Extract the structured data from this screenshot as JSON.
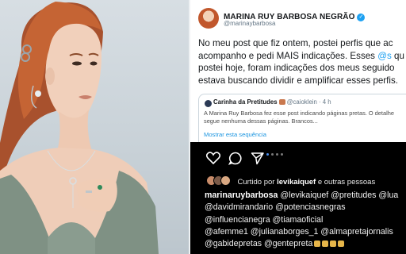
{
  "tweet": {
    "name": "MARINA RUY BARBOSA NEGRÃO",
    "handle": "@marinaybarbosa",
    "body_lines": [
      "No meu post que fiz ontem, postei perfis que ac",
      "acompanho e pedi MAIS indicações. Esses ",
      " qu",
      "postei hoje, foram indicações dos meus seguido",
      "estava buscando dividir e amplificar esses perfis."
    ],
    "body_mention": "@s",
    "quote": {
      "name": "Carinha da Pretitudes",
      "handle": "@caioklein · 4 h",
      "lines": [
        "A Marina Ruy Barbosa fez esse post indicando páginas pretas. O detalhe",
        "segue nenhuma dessas páginas. Brancos..."
      ],
      "link": "Mostrar esta sequência"
    }
  },
  "instagram": {
    "liked_by": "Curtido por",
    "liked_user": "levikaiquef",
    "liked_rest": "e outras pessoas",
    "caption_lines": [
      {
        "user": "marinaruybarbosa",
        "text": " @levikaiquef @pretitudes @lua"
      },
      {
        "text": "@davidmirandario @potenciasnegras"
      },
      {
        "text": "@influencianegra @tiamaoficial"
      },
      {
        "text": "@afemme1 @julianaborges_1 @almapretajornalis"
      },
      {
        "text": "@gabidepretas @gentepreta"
      }
    ],
    "icons": [
      "heart-icon",
      "comment-icon",
      "send-icon"
    ]
  },
  "colors": {
    "accent": "#1da1f2",
    "instagram_bg": "#000000",
    "text": "#14171a",
    "muted": "#657786"
  }
}
